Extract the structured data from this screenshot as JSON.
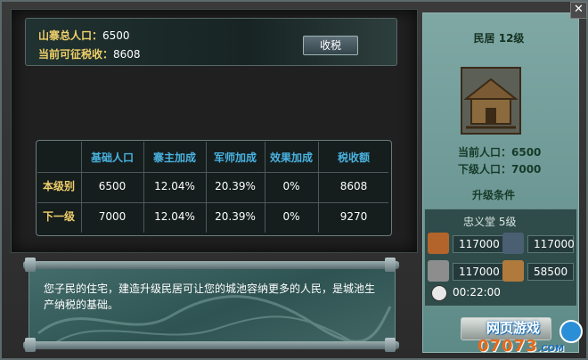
{
  "summary": {
    "population_label": "山寨总人口：",
    "population_value": "6500",
    "tax_label": "当前可征税收：",
    "tax_value": "8608",
    "collect_tax_button": "收税"
  },
  "table": {
    "headers": [
      "基础人口",
      "寨主加成",
      "军师加成",
      "效果加成",
      "税收额"
    ],
    "rows": [
      {
        "label": "本级别",
        "cells": [
          "6500",
          "12.04%",
          "20.39%",
          "0%",
          "8608"
        ]
      },
      {
        "label": "下一级",
        "cells": [
          "7000",
          "12.04%",
          "20.39%",
          "0%",
          "9270"
        ]
      }
    ]
  },
  "description": "您子民的住宅，建造升级民居可让您的城池容纳更多的人民，是城池生产纳税的基础。",
  "building": {
    "title": "民居 12级",
    "current_population": "当前人口：6500",
    "next_population": "下级人口：7000",
    "upgrade_title": "升级条件",
    "requirement_head": "忠义堂 5级",
    "resources": [
      {
        "icon": "wood-icon",
        "value": "117000",
        "color": "#b3642a"
      },
      {
        "icon": "stone-icon",
        "value": "117000",
        "color": "#4a5f72"
      },
      {
        "icon": "iron-icon",
        "value": "117000",
        "color": "#8d8d8d"
      },
      {
        "icon": "grain-icon",
        "value": "58500",
        "color": "#b07a3c"
      }
    ],
    "time": "00:22:00"
  },
  "watermark": {
    "line1": "网页游戏",
    "line2": "07073",
    "line2_suffix": ".COM"
  },
  "colors": {
    "gold_label": "#f0d06a",
    "header_blue": "#49b2e0",
    "panel_teal": "#6f9794"
  }
}
